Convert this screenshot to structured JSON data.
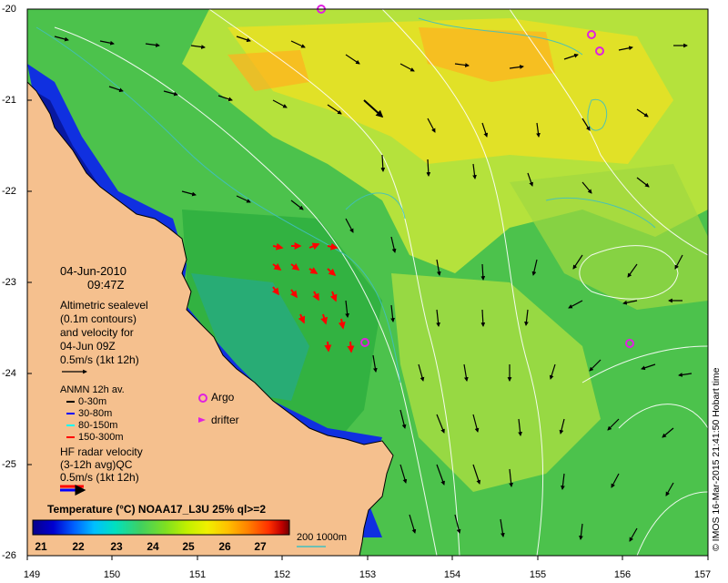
{
  "map": {
    "date": "04-Jun-2010",
    "time": "09:47Z",
    "lat_ticks": [
      "-20",
      "-21",
      "-22",
      "-23",
      "-24",
      "-25",
      "-26"
    ],
    "lon_ticks": [
      "149",
      "150",
      "151",
      "152",
      "153",
      "154",
      "155",
      "156",
      "157"
    ],
    "credit": "© IMOS 16-Mar-2015 21:41:50 Hobart time"
  },
  "altimetry": {
    "line1": "Altimetric sealevel",
    "line2": "(0.1m contours)",
    "line3": "and velocity for",
    "line4": "04-Jun 09Z",
    "scale": "0.5m/s (1kt 12h)"
  },
  "anmn": {
    "title": "ANMN 12h av.",
    "items": [
      {
        "label": "0-30m",
        "color": "#000000"
      },
      {
        "label": "30-80m",
        "color": "#0000ff"
      },
      {
        "label": "80-150m",
        "color": "#00ffff"
      },
      {
        "label": "150-300m",
        "color": "#ff0000"
      }
    ]
  },
  "markers": {
    "argo": "Argo",
    "drifter": "drifter",
    "argo_color": "#e020e0"
  },
  "hf": {
    "line1": "HF radar velocity",
    "line2": "(3-12h avg)QC",
    "scale": "0.5m/s (1kt 12h)"
  },
  "colorbar": {
    "title": "Temperature (°C) NOAA17_L3U 25% ql>=2",
    "labels": [
      "21",
      "22",
      "23",
      "24",
      "25",
      "26",
      "27"
    ],
    "colors": [
      "#08008a",
      "#0000d0",
      "#0060ff",
      "#00c0ff",
      "#00e0c0",
      "#40d060",
      "#80e020",
      "#c0f000",
      "#f0f000",
      "#ffc000",
      "#ff8000",
      "#ff3000",
      "#c00000",
      "#700000"
    ]
  },
  "contour_legend": {
    "label": "200  1000m",
    "color": "#40c0c0"
  },
  "colors": {
    "land": "#f5c08e",
    "ocean_green": "#4cc24c",
    "coast_blue": "#1030e0"
  }
}
